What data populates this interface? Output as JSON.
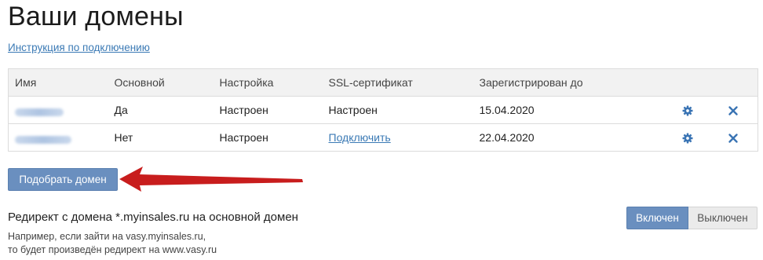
{
  "page": {
    "title": "Ваши домены",
    "help_link": "Инструкция по подключению"
  },
  "table": {
    "headers": [
      "Имя",
      "Основной",
      "Настройка",
      "SSL-сертификат",
      "Зарегистрирован до"
    ],
    "rows": [
      {
        "name": "",
        "primary": "Да",
        "setup": "Настроен",
        "ssl": "Настроен",
        "ssl_is_link": false,
        "registered_until": "15.04.2020"
      },
      {
        "name": "",
        "primary": "Нет",
        "setup": "Настроен",
        "ssl": "Подключить",
        "ssl_is_link": true,
        "registered_until": "22.04.2020"
      }
    ]
  },
  "actions": {
    "pick_domain": "Подобрать домен"
  },
  "redirect": {
    "title": "Редирект с домена *.myinsales.ru на основной домен",
    "description_line1": "Например, если зайти на vasy.myinsales.ru,",
    "description_line2": "то будет произведён редирект на www.vasy.ru",
    "toggle_on": "Включен",
    "toggle_off": "Выключен",
    "selected": "on"
  },
  "colors": {
    "accent": "#6a8fbf",
    "link": "#3b7ab5",
    "arrow": "#c81d1d"
  },
  "icons": [
    "gear-icon",
    "close-icon",
    "arrow-annotation"
  ]
}
